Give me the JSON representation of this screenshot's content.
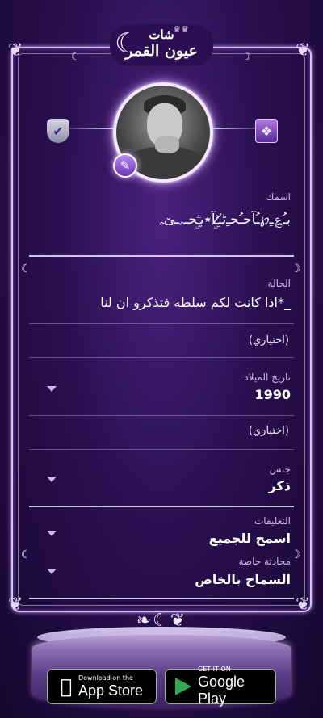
{
  "app": {
    "logo_line1": "شات",
    "logo_line2": "عيون القمر"
  },
  "profile": {
    "name_label": "اسمك",
    "name_value": "ﺑـُ؏ـِ℘ـُآحـُحـِﮢ̸ــََۣ۫ﺂ٭ﯾـِۣۧحـﮧـێﮧ",
    "status_label": "الحالة",
    "status_value": "_*اذا كانت لكم سلطه فتذكرو ان لنا",
    "optional_1": "(اختياري)",
    "birth_label": "تاريخ الميلاد",
    "birth_value": "1990",
    "optional_2": "(اختياري)",
    "gender_label": "جنس",
    "gender_value": "ذكر",
    "comments_label": "التعليقات",
    "comments_value": "اسمح للجميع",
    "private_chat_label": "محادثة خاصة",
    "private_chat_value": "السماح بالخاص"
  },
  "icons": {
    "left": "shield-check-icon",
    "right": "book-icon",
    "edit": "pencil-icon"
  },
  "stores": {
    "apple_small": "Download on the",
    "apple_big": "App Store",
    "google_small": "GET IT ON",
    "google_big": "Google Play"
  },
  "colors": {
    "background": "#2a1050",
    "frame": "#d9c4f5",
    "label": "#cdb8ee"
  }
}
